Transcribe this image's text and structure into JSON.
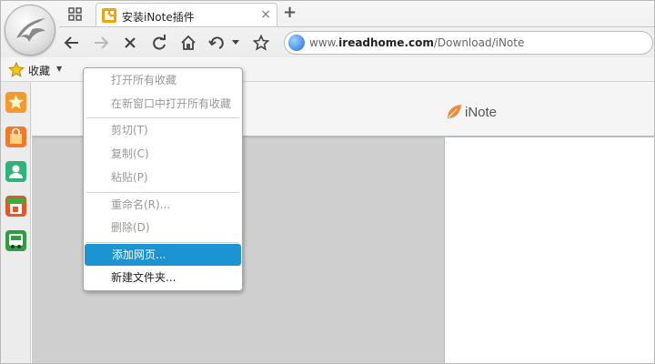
{
  "tab": {
    "title": "安装iNote插件",
    "close_glyph": "×"
  },
  "new_tab_glyph": "+",
  "address": {
    "prefix": "www.",
    "domain": "ireadhome.com",
    "path": "/Download/iNote"
  },
  "bookmarks": {
    "label": "收藏",
    "caret": "▼"
  },
  "page": {
    "brand": "iNote"
  },
  "context_menu": {
    "items": [
      {
        "label": "打开所有收藏",
        "enabled": false
      },
      {
        "label": "在新窗口中打开所有收藏",
        "enabled": false
      },
      {
        "label": "剪切(T)",
        "enabled": false
      },
      {
        "label": "复制(C)",
        "enabled": false
      },
      {
        "label": "粘贴(P)",
        "enabled": false
      },
      {
        "label": "重命名(R)...",
        "enabled": false
      },
      {
        "label": "删除(D)",
        "enabled": false
      },
      {
        "label": "添加网页...",
        "enabled": true,
        "selected": true
      },
      {
        "label": "新建文件夹...",
        "enabled": true
      }
    ]
  },
  "sidebar_icons": [
    "star-icon",
    "shopping-bag-icon",
    "contacts-icon",
    "store-icon",
    "bus-icon"
  ],
  "colors": {
    "accent": "#1c93d2",
    "brand_orange": "#f08a3a"
  }
}
